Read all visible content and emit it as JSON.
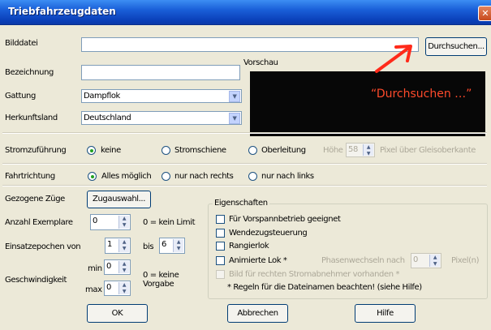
{
  "window": {
    "title": "Triebfahrzeugdaten",
    "close_glyph": "✕"
  },
  "labels": {
    "bilddatei": "Bilddatei",
    "bezeichnung": "Bezeichnung",
    "gattung": "Gattung",
    "herkunftsland": "Herkunftsland",
    "vorschau": "Vorschau",
    "stromzufuehrung": "Stromzuführung",
    "fahrtrichtung": "Fahrtrichtung",
    "gezogene_zuege": "Gezogene Züge",
    "anzahl_exemplare": "Anzahl Exemplare",
    "anzahl_hint": "0 = kein Limit",
    "einsatzepochen": "Einsatzepochen von",
    "bis": "bis",
    "geschwindigkeit": "Geschwindigkeit",
    "min": "min",
    "max": "max",
    "speed_hint_1": "0 = keine",
    "speed_hint_2": "Vorgabe",
    "hoehe": "Höhe",
    "hoehe_suffix": "Pixel über Gleisoberkante",
    "eigenschaften": "Eigenschaften",
    "phasen": "Phasenwechseln nach",
    "pixel": "Pixel(n)"
  },
  "fields": {
    "bilddatei": "",
    "bezeichnung": "",
    "gattung": "Dampflok",
    "herkunftsland": "Deutschland",
    "hoehe": "58",
    "anzahl": "0",
    "von": "1",
    "bis": "6",
    "min": "0",
    "max": "0",
    "phasen": "0"
  },
  "buttons": {
    "durchsuchen": "Durchsuchen...",
    "zugauswahl": "Zugauswahl...",
    "ok": "OK",
    "abbrechen": "Abbrechen",
    "hilfe": "Hilfe"
  },
  "strom": {
    "options": [
      "keine",
      "Stromschiene",
      "Oberleitung"
    ],
    "selected": "keine"
  },
  "fahrt": {
    "options": [
      "Alles möglich",
      "nur nach rechts",
      "nur nach links"
    ],
    "selected": "Alles möglich"
  },
  "eigen": {
    "items": [
      "Für Vorspannbetrieb geeignet",
      "Wendezugsteuerung",
      "Rangierlok",
      "Animierte Lok *",
      "Bild für rechten Stromabnehmer vorhanden *"
    ],
    "note": "* Regeln für die Dateinamen beachten! (siehe Hilfe)"
  },
  "annotation": {
    "text": "“Durchsuchen …”",
    "color": "#ff4a2b"
  },
  "colors": {
    "title_bar": "#1a5fd8",
    "dialog_bg": "#ece9d8",
    "preview_bg": "#070707"
  }
}
